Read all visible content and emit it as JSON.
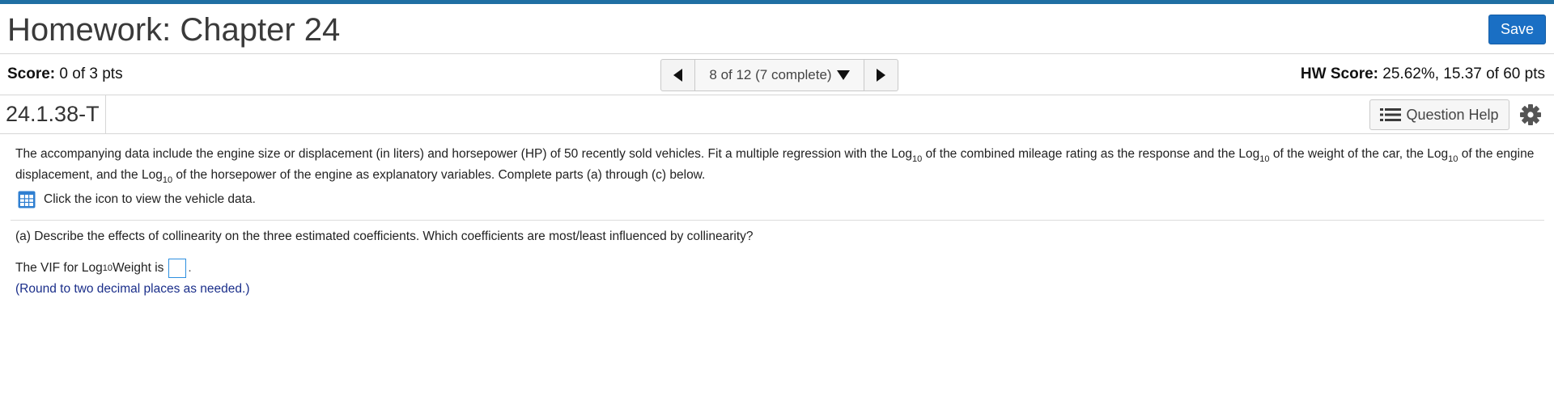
{
  "header": {
    "title": "Homework: Chapter 24",
    "save_label": "Save"
  },
  "scorebar": {
    "score_label": "Score:",
    "score_value": "0 of 3 pts",
    "nav_position": "8 of 12 (7 complete)",
    "hw_score_label": "HW Score:",
    "hw_score_value": "25.62%, 15.37 of 60 pts"
  },
  "question": {
    "id": "24.1.38-T",
    "help_label": "Question Help"
  },
  "content": {
    "intro_1": "The accompanying data include the engine size or displacement (in liters) and horsepower (HP) of 50 recently sold vehicles. Fit a multiple regression with the Log",
    "intro_2": " of the combined mileage rating as the response and the Log",
    "intro_3": " of the weight of the car, the Log",
    "intro_4": " of the engine displacement, and the Log",
    "intro_5": " of the horsepower of the engine as explanatory variables. Complete parts (a) through (c) below.",
    "log_base": "10",
    "data_link": "Click the icon to view the vehicle data.",
    "part_a": "(a) Describe the effects of collinearity on the three estimated coefficients. Which coefficients are most/least influenced by collinearity?",
    "vif_pre": "The VIF for Log",
    "vif_post": "Weight is",
    "vif_period": ".",
    "hint": "(Round to two decimal places as needed.)"
  },
  "icons": {
    "prev": "triangle-left-icon",
    "next": "triangle-right-icon",
    "dropdown": "triangle-down-icon",
    "help": "list-icon",
    "settings": "gear-icon",
    "data": "table-icon"
  },
  "colors": {
    "top_bar": "#1f6fa3",
    "save_button": "#1a6fc4",
    "hint_text": "#1a2e8a",
    "answer_box_border": "#2d8fe0"
  }
}
